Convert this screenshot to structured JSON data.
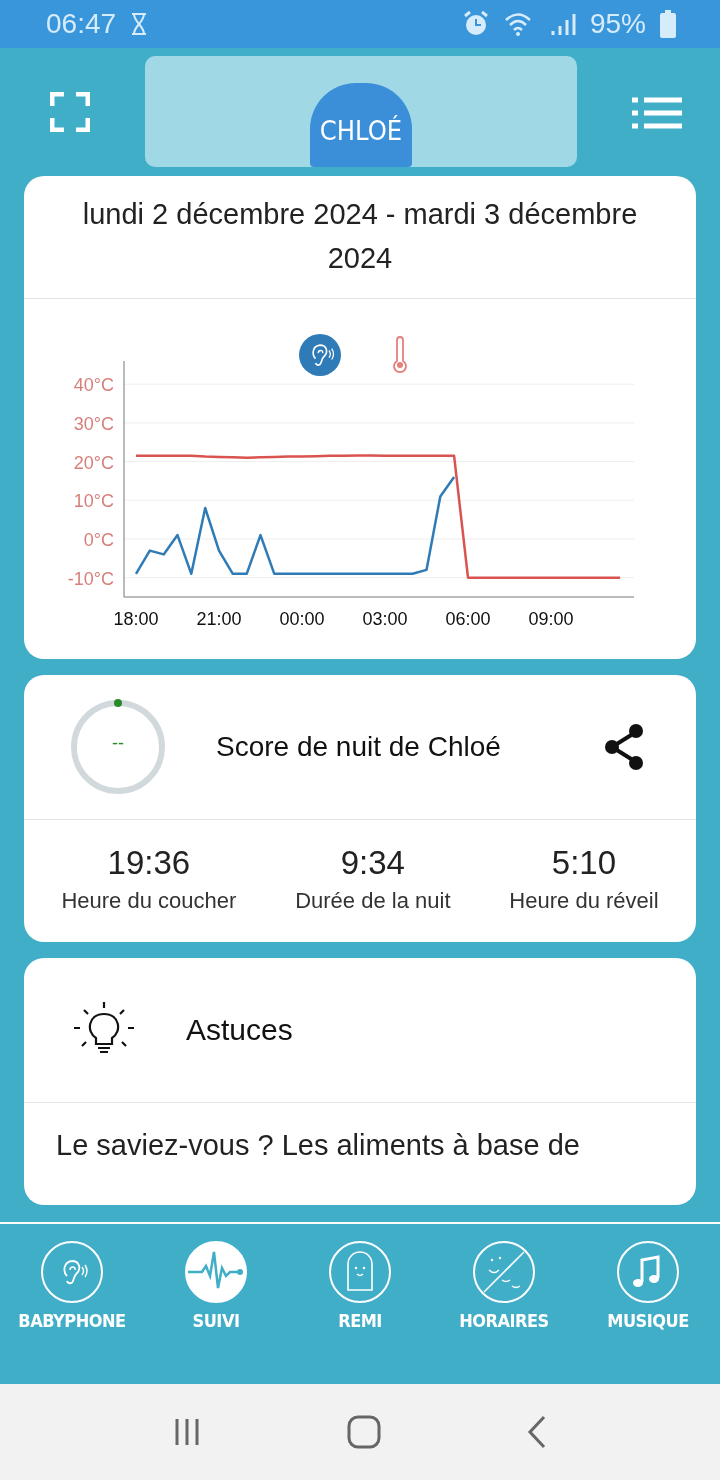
{
  "status_bar": {
    "time": "06:47",
    "battery": "95%"
  },
  "header": {
    "child_name": "CHLOÉ"
  },
  "chart_card": {
    "date_range": "lundi 2 décembre 2024 - mardi 3 décembre 2024",
    "legend": [
      {
        "kind": "sound",
        "selected": true
      },
      {
        "kind": "temperature",
        "selected": false
      }
    ],
    "chart_data": {
      "type": "line",
      "categories": [
        "18:00",
        null,
        null,
        null,
        null,
        null,
        "21:00",
        null,
        null,
        null,
        null,
        null,
        "00:00",
        null,
        null,
        null,
        null,
        null,
        "03:00",
        null,
        null,
        null,
        null,
        null,
        "06:00",
        null,
        null,
        null,
        null,
        null,
        "09:00",
        null,
        null,
        null,
        null,
        null
      ],
      "ylim": [
        -15,
        46
      ],
      "grid": true,
      "yticks": [
        {
          "value": -10,
          "label": "-10°C"
        },
        {
          "value": 0,
          "label": "0°C"
        },
        {
          "value": 10,
          "label": "10°C"
        },
        {
          "value": 20,
          "label": "20°C"
        },
        {
          "value": 30,
          "label": "30°C"
        },
        {
          "value": 40,
          "label": "40°C"
        }
      ],
      "series": [
        {
          "color": "#2e7bb8",
          "values": [
            -9,
            -3,
            -4,
            1,
            -9,
            8,
            -3,
            -9,
            -9,
            1,
            -9,
            -9,
            -9,
            -9,
            -9,
            -9,
            -9,
            -9,
            -9,
            -9,
            -9,
            -8,
            11,
            16,
            null,
            null,
            null,
            null,
            null,
            null,
            null,
            null,
            null,
            null,
            null,
            null
          ]
        },
        {
          "color": "#d9534f",
          "values": [
            21.5,
            21.5,
            21.5,
            21.5,
            21.5,
            21.3,
            21.2,
            21.1,
            21.0,
            21.1,
            21.2,
            21.3,
            21.3,
            21.4,
            21.5,
            21.5,
            21.6,
            21.6,
            21.5,
            21.5,
            21.5,
            21.5,
            21.5,
            21.5,
            -10,
            -10,
            -10,
            -10,
            -10,
            -10,
            -10,
            -10,
            -10,
            -10,
            -10,
            -10
          ]
        }
      ]
    }
  },
  "score_card": {
    "score": "--",
    "title": "Score de nuit de Chloé",
    "stats": [
      {
        "value": "19:36",
        "label": "Heure du coucher"
      },
      {
        "value": "9:34",
        "label": "Durée de la nuit"
      },
      {
        "value": "5:10",
        "label": "Heure du réveil"
      }
    ]
  },
  "tips_card": {
    "title": "Astuces",
    "text": "Le saviez-vous ? Les aliments à base de"
  },
  "bottom_nav": [
    {
      "kind": "ear",
      "label": "BABYPHONE",
      "selected": false
    },
    {
      "kind": "pulse",
      "label": "SUIVI",
      "selected": true
    },
    {
      "kind": "remi",
      "label": "REMI",
      "selected": false
    },
    {
      "kind": "schedule",
      "label": "HORAIRES",
      "selected": false
    },
    {
      "kind": "music",
      "label": "MUSIQUE",
      "selected": false
    }
  ]
}
